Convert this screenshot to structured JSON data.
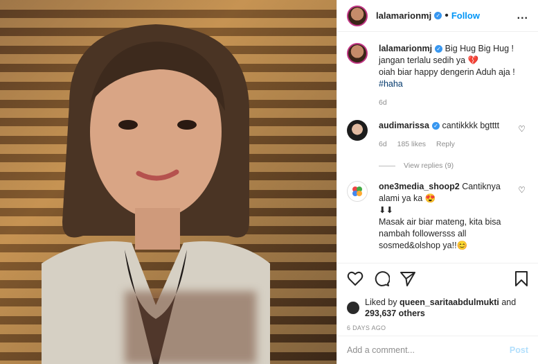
{
  "header": {
    "username": "lalamarionmj",
    "dot": "•",
    "follow_label": "Follow",
    "more": "..."
  },
  "caption": {
    "username": "lalamarionmj",
    "line1": "Big Hug Big Hug !",
    "line2": "jangan terlalu sedih ya 💔",
    "line3": "oiah biar happy dengerin Aduh aja !",
    "hashtag": "#haha",
    "time": "6d"
  },
  "comments": [
    {
      "username": "audimarissa",
      "text": "cantikkkk bgtttt",
      "time": "6d",
      "likes": "185 likes",
      "reply": "Reply",
      "view_replies": "View replies (9)"
    },
    {
      "username": "one3media_shoop2",
      "text": "Cantiknya alami ya ka 😍",
      "line2": "⬇⬇",
      "line3": "Masak air biar mateng, kita bisa nambah followersss all sosmed&olshop ya!!😊"
    }
  ],
  "likes": {
    "prefix": "Liked by",
    "user": "queen_saritaabdulmukti",
    "and": "and",
    "count": "293,637 others"
  },
  "date": "6 DAYS AGO",
  "add_comment": {
    "placeholder": "Add a comment...",
    "post_label": "Post"
  }
}
